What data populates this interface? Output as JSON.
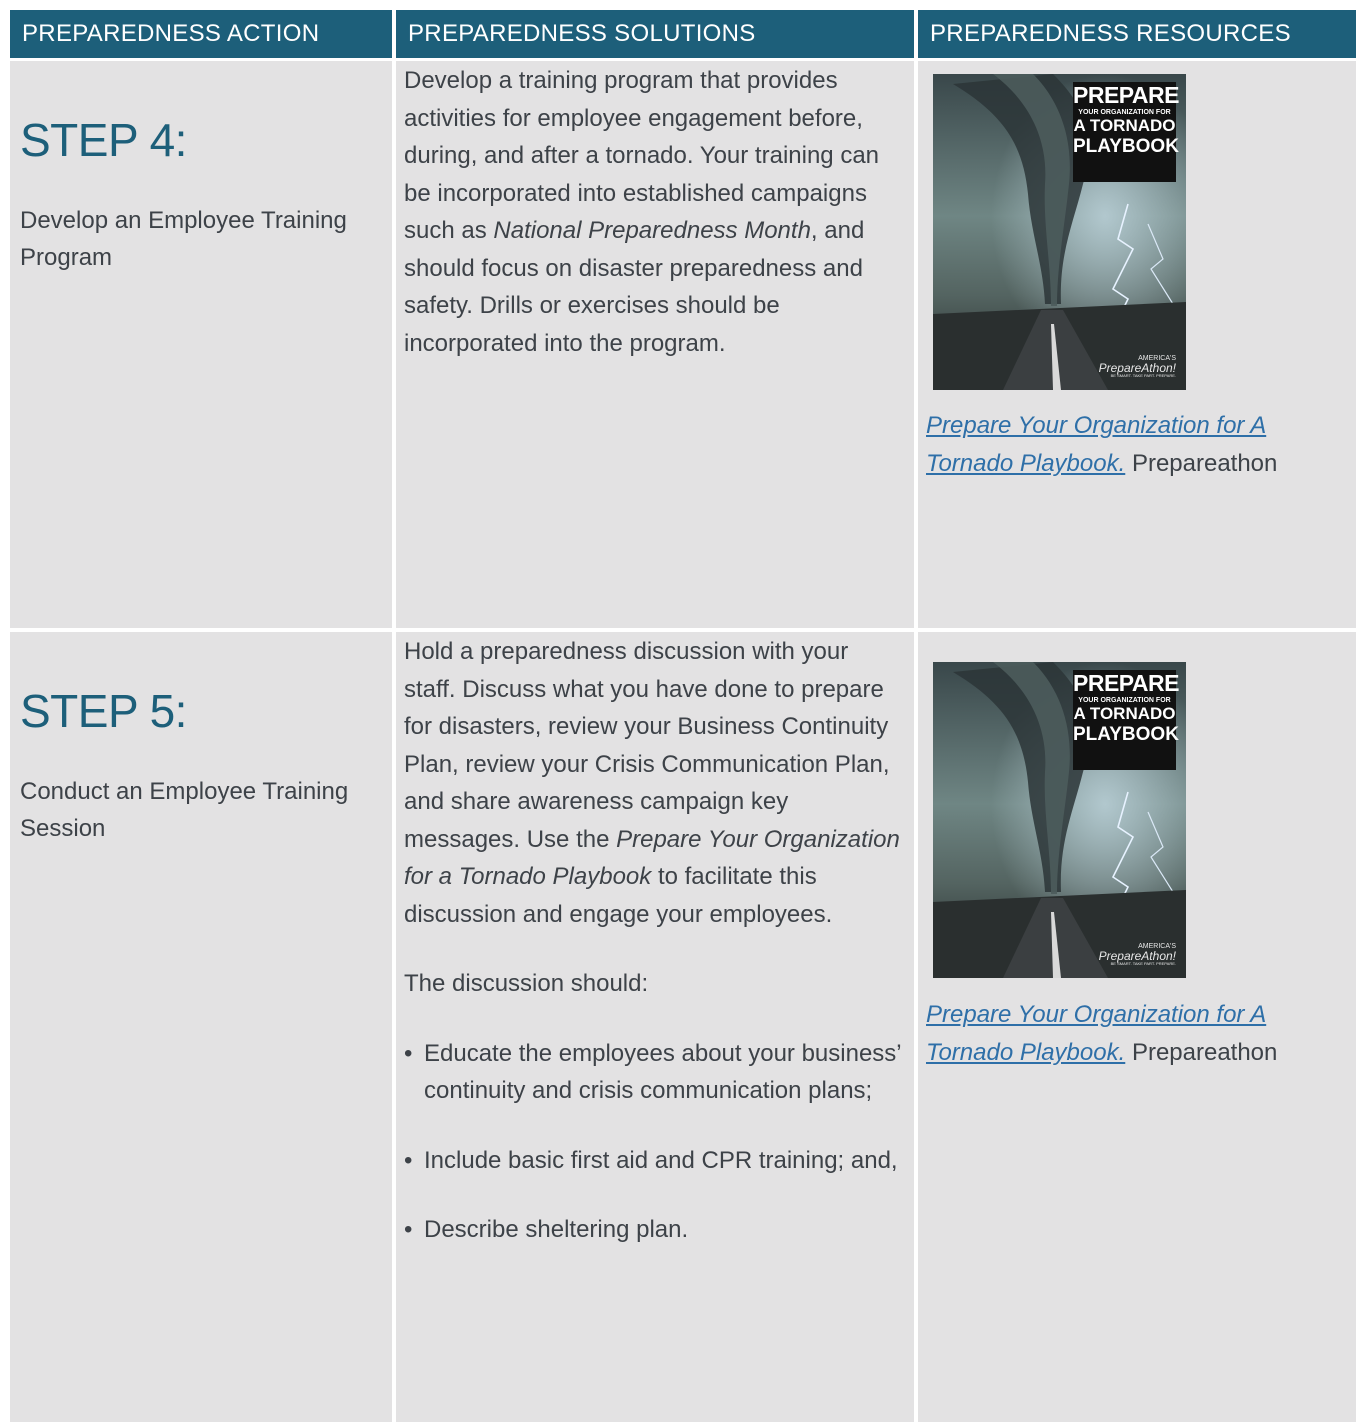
{
  "headers": {
    "action": "PREPAREDNESS ACTION",
    "solutions": "PREPAREDNESS SOLUTIONS",
    "resources": "PREPAREDNESS RESOURCES"
  },
  "rows": [
    {
      "step": "STEP 4:",
      "action": "Develop an Employee Training Program",
      "solution": {
        "p1_a": "Develop a training program that provides activities for employee engagement before, during, and after a tornado. Your training can be incorporated into established campaigns such as ",
        "p1_em": "National Preparedness Month",
        "p1_b": ", and should focus on disaster preparedness and safety. Drills or exercises should be incorporated into the program."
      },
      "resource": {
        "link": "Prepare Your Organization for A Tornado Playbook.",
        "source": "Prepareathon"
      }
    },
    {
      "step": "STEP 5:",
      "action": "Conduct an Employee Training Session",
      "solution": {
        "p1_a": "Hold a preparedness discussion with your staff. Discuss what you have done to prepare for disasters, review your Business Continuity Plan, review your Crisis Communication Plan, and share awareness campaign key messages. Use the ",
        "p1_em": "Prepare Your Organization for a Tornado Playbook",
        "p1_b": " to facilitate this discussion and engage your employees.",
        "p2": "The discussion should:",
        "bullets": [
          "Educate the employees about your business’ continuity and crisis communication plans;",
          "Include basic first aid and CPR training; and,",
          "Describe sheltering plan."
        ]
      },
      "resource": {
        "link": "Prepare Your Organization for A Tornado Playbook.",
        "source": "Prepareathon"
      }
    }
  ],
  "cover": {
    "title_line1": "PREPARE",
    "title_line2": "YOUR ORGANIZATION FOR",
    "title_line3": "A TORNADO",
    "title_line4": "PLAYBOOK",
    "brand_small": "AMERICA'S",
    "brand": "PrepareAthon!",
    "tagline": "BE SMART. TAKE PART. PREPARE."
  },
  "colors": {
    "header_bg": "#1d5f7a",
    "cell_bg": "#e3e2e3",
    "step_title": "#1d5f7a",
    "link": "#2e6fa8"
  }
}
